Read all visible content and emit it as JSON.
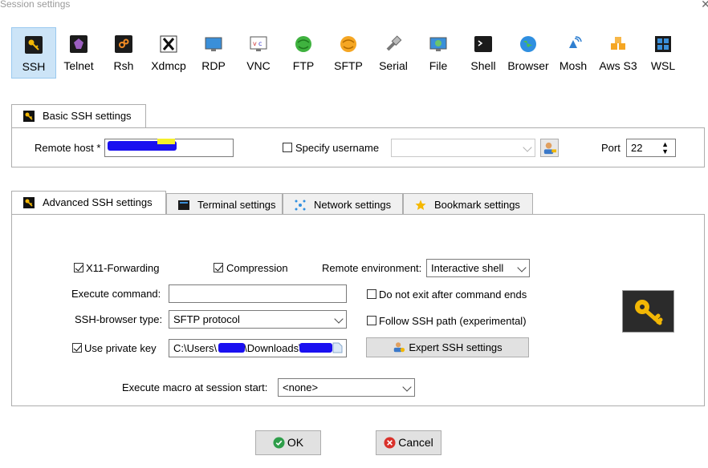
{
  "window": {
    "title": "Session settings",
    "close": "✕"
  },
  "session_types": [
    {
      "label": "SSH",
      "icon": "ssh-key-icon",
      "selected": true
    },
    {
      "label": "Telnet",
      "icon": "telnet-icon"
    },
    {
      "label": "Rsh",
      "icon": "rsh-icon"
    },
    {
      "label": "Xdmcp",
      "icon": "xdmcp-icon"
    },
    {
      "label": "RDP",
      "icon": "rdp-icon"
    },
    {
      "label": "VNC",
      "icon": "vnc-icon"
    },
    {
      "label": "FTP",
      "icon": "ftp-icon"
    },
    {
      "label": "SFTP",
      "icon": "sftp-icon"
    },
    {
      "label": "Serial",
      "icon": "serial-icon"
    },
    {
      "label": "File",
      "icon": "file-icon"
    },
    {
      "label": "Shell",
      "icon": "shell-icon"
    },
    {
      "label": "Browser",
      "icon": "browser-icon"
    },
    {
      "label": "Mosh",
      "icon": "mosh-icon"
    },
    {
      "label": "Aws S3",
      "icon": "aws-s3-icon"
    },
    {
      "label": "WSL",
      "icon": "wsl-icon"
    }
  ],
  "basic": {
    "tab_label": "Basic SSH settings",
    "remote_host_label": "Remote host *",
    "remote_host_value": "",
    "specify_username_label": "Specify username",
    "specify_username_checked": false,
    "username_value": "",
    "port_label": "Port",
    "port_value": "22"
  },
  "tabs": [
    {
      "label": "Advanced SSH settings",
      "icon": "key-icon",
      "active": true
    },
    {
      "label": "Terminal settings",
      "icon": "terminal-icon"
    },
    {
      "label": "Network settings",
      "icon": "network-icon"
    },
    {
      "label": "Bookmark settings",
      "icon": "star-icon"
    }
  ],
  "advanced": {
    "x11_label": "X11-Forwarding",
    "x11_checked": true,
    "compression_label": "Compression",
    "compression_checked": true,
    "remote_env_label": "Remote environment:",
    "remote_env_value": "Interactive shell",
    "execute_command_label": "Execute command:",
    "execute_command_value": "",
    "do_not_exit_label": "Do not exit after command ends",
    "do_not_exit_checked": false,
    "browser_type_label": "SSH-browser type:",
    "browser_type_value": "SFTP protocol",
    "follow_path_label": "Follow SSH path (experimental)",
    "follow_path_checked": false,
    "private_key_label": "Use private key",
    "private_key_checked": true,
    "private_key_value_prefix": "C:\\Users\\",
    "private_key_value_middle": "\\Downloads\\",
    "expert_button_label": "Expert SSH settings",
    "macro_label": "Execute macro at session start:",
    "macro_value": "<none>"
  },
  "buttons": {
    "ok": "OK",
    "cancel": "Cancel"
  },
  "colors": {
    "selection_bg": "#cce4f7",
    "ok_green": "#2e9e4a",
    "cancel_red": "#d9312b",
    "key_gold": "#f2b705"
  }
}
